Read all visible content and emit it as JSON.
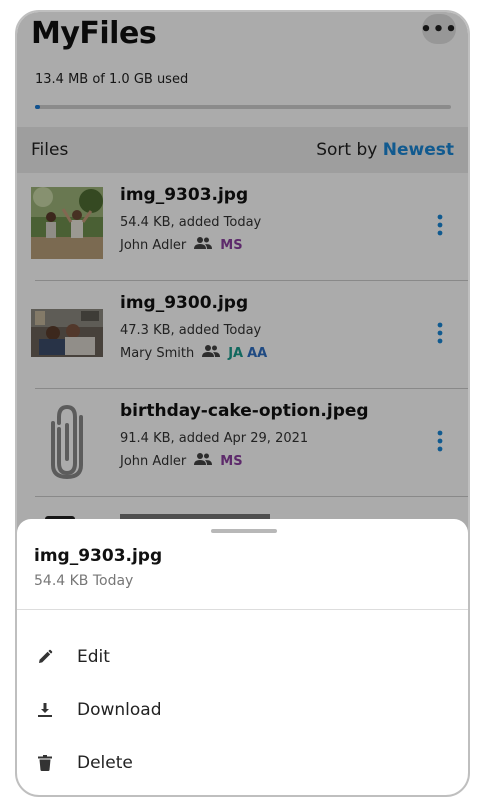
{
  "header": {
    "title": "MyFiles",
    "more_icon": "more-horizontal-icon",
    "storage_text": "13.4 MB of 1.0 GB used",
    "storage_fraction": 0.013
  },
  "files_section": {
    "label": "Files",
    "sort_label": "Sort by",
    "sort_value": "Newest"
  },
  "files": [
    {
      "name": "img_9303.jpg",
      "meta": "54.4 KB, added Today",
      "owner": "John Adler",
      "thumb": "photo-thumbnail",
      "shared_with": [
        {
          "initials": "MS",
          "color": "#8b3fa0"
        }
      ]
    },
    {
      "name": "img_9300.jpg",
      "meta": "47.3 KB, added Today",
      "owner": "Mary Smith",
      "thumb": "photo-thumbnail",
      "shared_with": [
        {
          "initials": "JA",
          "color": "#1a9c8c"
        },
        {
          "initials": "AA",
          "color": "#2f6fc2"
        }
      ]
    },
    {
      "name": "birthday-cake-option.jpeg",
      "meta": "91.4 KB, added Apr 29, 2021",
      "owner": "John Adler",
      "thumb": "paperclip-icon",
      "shared_with": [
        {
          "initials": "MS",
          "color": "#8b3fa0"
        }
      ]
    }
  ],
  "sheet": {
    "title": "img_9303.jpg",
    "subtitle": "54.4 KB Today",
    "actions": [
      {
        "label": "Edit",
        "icon": "pencil-icon"
      },
      {
        "label": "Download",
        "icon": "download-icon"
      },
      {
        "label": "Delete",
        "icon": "trash-icon"
      }
    ]
  },
  "colors": {
    "accent": "#1a87d6",
    "overlay": "rgba(0,0,0,0.33)"
  }
}
